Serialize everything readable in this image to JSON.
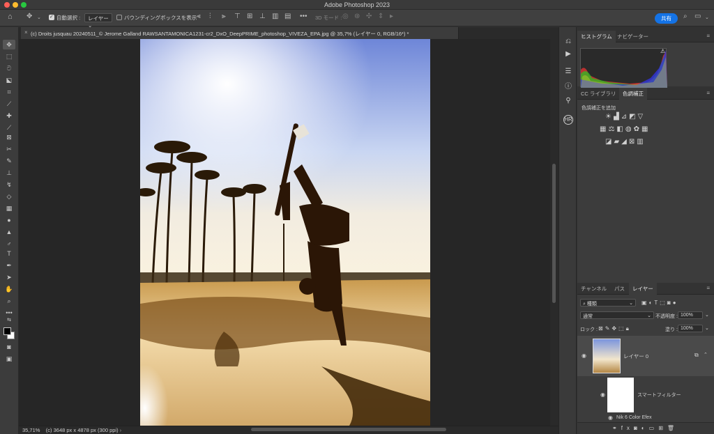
{
  "app": {
    "title": "Adobe Photoshop 2023"
  },
  "options_bar": {
    "auto_select_label": "自動選択 :",
    "auto_select_value": "レイヤー",
    "bounding_box_label": "バウンディングボックスを表示",
    "mode_3d_label": "3D モード :",
    "share_label": "共有"
  },
  "document": {
    "tab_title": "(c) Droits jusquau 20240511_© Jerome Galland RAWSANTAMONICA1231-cr2_DxO_DeepPRIME_photoshop_VIVEZA_EPA.jpg @ 35,7% (レイヤー 0, RGB/16*) *"
  },
  "status_bar": {
    "zoom": "35,71%",
    "info": "(c) 3648 px x 4878 px (300 ppi)"
  },
  "panels": {
    "histogram_tabs": [
      "ヒストグラム",
      "ナビゲーター"
    ],
    "adjustment_tabs": [
      "CC ライブラリ",
      "色調補正"
    ],
    "adjustment_title": "色調補正を追加",
    "layer_tabs": [
      "チャンネル",
      "パス",
      "レイヤー"
    ]
  },
  "layers": {
    "filter_kind": "種類",
    "blend_mode": "通常",
    "opacity_label": "不透明度 :",
    "opacity_value": "100%",
    "lock_label": "ロック :",
    "fill_label": "塗り :",
    "fill_value": "100%",
    "items": [
      {
        "name": "レイヤー 0"
      },
      {
        "name": "スマートフィルター"
      },
      {
        "name": "Nik 6 Color Efex"
      }
    ]
  },
  "colors": {
    "accent": "#1473e6",
    "traffic_close": "#ff5f57",
    "traffic_min": "#febc2e",
    "traffic_max": "#28c840"
  }
}
